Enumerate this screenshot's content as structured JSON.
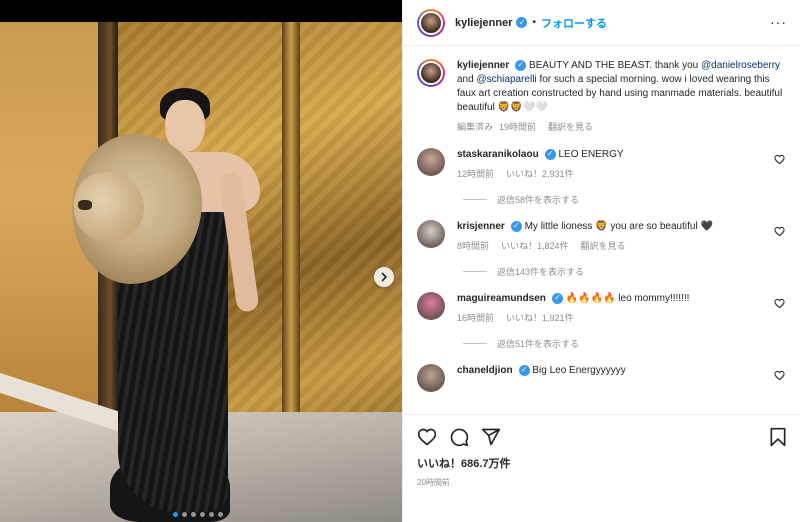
{
  "post": {
    "images_count": 6,
    "active_image_index": 0
  },
  "header": {
    "username": "kyliejenner",
    "separator": "•",
    "follow_label": "フォローする",
    "more_label": "···"
  },
  "caption": {
    "username": "kyliejenner",
    "text_1": "BEAUTY AND THE BEAST. thank you",
    "mention_1": "@danielroseberry",
    "text_2": "and",
    "mention_2": "@schiaparelli",
    "text_3": "for such a special morning. wow i loved wearing this faux art creation constructed by hand using manmade materials. beautiful beautiful 🦁🦁🤍🤍",
    "edited": "編集済み",
    "time": "19時間前",
    "translate": "翻訳を見る"
  },
  "comments": [
    {
      "username": "staskaranikolaou",
      "verified": true,
      "text": "LEO ENERGY",
      "time": "12時間前",
      "likes": "いいね！2,931件",
      "translate": "",
      "replies": "返信58件を表示する"
    },
    {
      "username": "krisjenner",
      "verified": true,
      "text": "My little lioness 🦁 you are so beautiful 🖤",
      "time": "8時間前",
      "likes": "いいね！1,824件",
      "translate": "翻訳を見る",
      "replies": "返信143件を表示する"
    },
    {
      "username": "maguireamundsen",
      "verified": true,
      "text": "🔥🔥🔥🔥 leo mommy!!!!!!!",
      "time": "16時間前",
      "likes": "いいね！1,921件",
      "translate": "",
      "replies": "返信51件を表示する"
    },
    {
      "username": "chaneldjion",
      "verified": true,
      "text": "Big Leo Energyyyyyy",
      "time": "",
      "likes": "",
      "translate": "",
      "replies": ""
    }
  ],
  "footer": {
    "likes": "いいね！686.7万件",
    "posted": "20時間前"
  },
  "colors": {
    "accent": "#0095f6",
    "verified": "#3897f0",
    "text": "#262626",
    "muted": "#8e8e8e",
    "border": "#efefef",
    "carousel_dot_active": "#1d9bf0"
  },
  "icons": [
    "more-icon",
    "verified-icon",
    "heart-icon",
    "comment-icon",
    "share-icon",
    "bookmark-icon",
    "chevron-right-icon"
  ]
}
